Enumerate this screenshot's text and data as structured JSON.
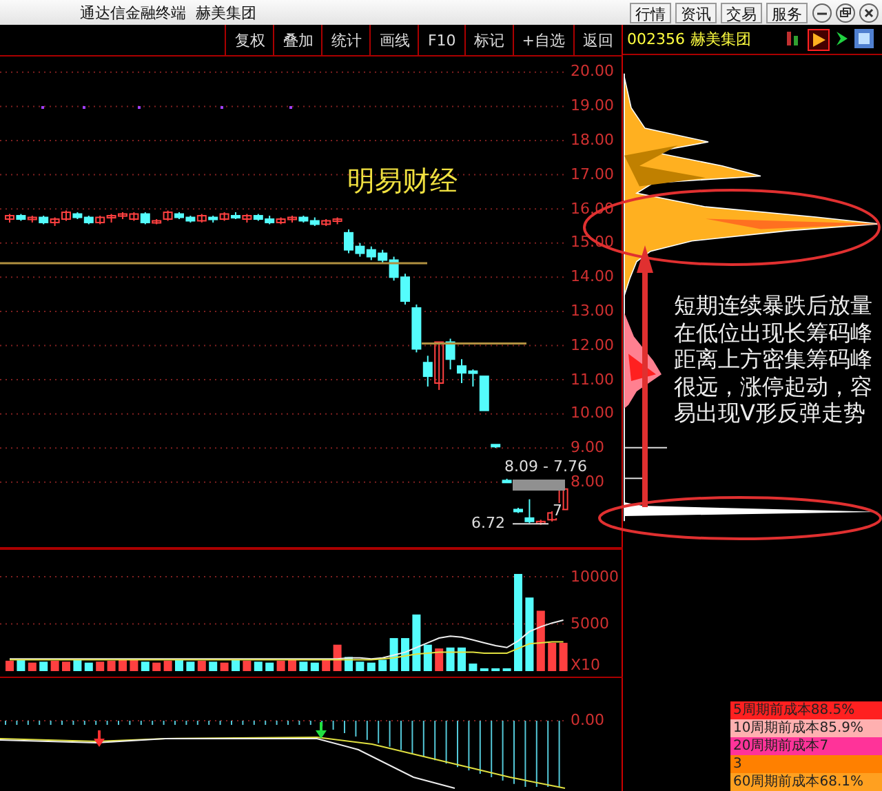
{
  "window": {
    "title": "通达信金融终端  赫美集团"
  },
  "top_buttons": [
    "行情",
    "资讯",
    "交易",
    "服务"
  ],
  "toolbar": {
    "buttons": [
      "复权",
      "叠加",
      "统计",
      "画线",
      "F10",
      "标记",
      "+自选",
      "返回"
    ]
  },
  "stock": {
    "code": "002356",
    "name": "赫美集团"
  },
  "price_chart": {
    "overlay_text": "明易财经",
    "range_label": "8.09 - 7.76",
    "low_label": "6.72",
    "cut_label": "7",
    "chart_data": {
      "type": "candlestick",
      "ohlc": [
        [
          15.7,
          15.85,
          15.6,
          15.8
        ],
        [
          15.8,
          15.85,
          15.65,
          15.7
        ],
        [
          15.7,
          15.8,
          15.6,
          15.75
        ],
        [
          15.75,
          15.8,
          15.55,
          15.6
        ],
        [
          15.6,
          15.75,
          15.5,
          15.7
        ],
        [
          15.7,
          15.95,
          15.65,
          15.9
        ],
        [
          15.85,
          15.9,
          15.7,
          15.75
        ],
        [
          15.75,
          15.8,
          15.55,
          15.6
        ],
        [
          15.6,
          15.8,
          15.55,
          15.75
        ],
        [
          15.75,
          15.85,
          15.6,
          15.8
        ],
        [
          15.8,
          15.9,
          15.7,
          15.85
        ],
        [
          15.7,
          15.9,
          15.65,
          15.85
        ],
        [
          15.85,
          15.9,
          15.55,
          15.6
        ],
        [
          15.6,
          15.7,
          15.55,
          15.65
        ],
        [
          15.7,
          15.95,
          15.65,
          15.9
        ],
        [
          15.85,
          15.9,
          15.7,
          15.75
        ],
        [
          15.75,
          15.8,
          15.6,
          15.65
        ],
        [
          15.65,
          15.85,
          15.6,
          15.8
        ],
        [
          15.75,
          15.8,
          15.6,
          15.7
        ],
        [
          15.7,
          15.9,
          15.65,
          15.85
        ],
        [
          15.8,
          15.9,
          15.7,
          15.75
        ],
        [
          15.7,
          15.85,
          15.6,
          15.8
        ],
        [
          15.8,
          15.85,
          15.65,
          15.7
        ],
        [
          15.7,
          15.8,
          15.55,
          15.6
        ],
        [
          15.6,
          15.75,
          15.55,
          15.7
        ],
        [
          15.7,
          15.8,
          15.6,
          15.75
        ],
        [
          15.75,
          15.8,
          15.6,
          15.65
        ],
        [
          15.65,
          15.75,
          15.5,
          15.55
        ],
        [
          15.55,
          15.7,
          15.5,
          15.65
        ],
        [
          15.65,
          15.75,
          15.55,
          15.7
        ],
        [
          15.3,
          15.4,
          14.7,
          14.8
        ],
        [
          14.9,
          15.0,
          14.6,
          14.7
        ],
        [
          14.8,
          14.9,
          14.5,
          14.6
        ],
        [
          14.7,
          14.8,
          14.4,
          14.5
        ],
        [
          14.5,
          14.6,
          13.9,
          14.0
        ],
        [
          14.0,
          14.1,
          13.2,
          13.3
        ],
        [
          13.1,
          13.2,
          11.8,
          11.9
        ],
        [
          11.5,
          11.7,
          10.8,
          11.1
        ],
        [
          10.9,
          12.1,
          10.7,
          12.1
        ],
        [
          12.1,
          12.2,
          11.3,
          11.6
        ],
        [
          11.4,
          11.6,
          10.9,
          11.2
        ],
        [
          11.25,
          11.3,
          10.8,
          11.2
        ],
        [
          11.1,
          11.1,
          10.1,
          10.1
        ],
        [
          9.1,
          9.1,
          9.0,
          9.05
        ],
        [
          8.05,
          8.1,
          8.0,
          8.0
        ],
        [
          7.2,
          7.25,
          7.1,
          7.15
        ],
        [
          6.95,
          7.5,
          6.8,
          6.85
        ],
        [
          6.8,
          6.9,
          6.75,
          6.85
        ],
        [
          6.9,
          7.15,
          6.85,
          7.1
        ],
        [
          7.2,
          7.8,
          7.2,
          7.8
        ]
      ],
      "ylim": [
        6.1,
        20.5
      ],
      "grid": true,
      "yticks": [
        {
          "value": 20,
          "label": "20.00"
        },
        {
          "value": 19,
          "label": "19.00"
        },
        {
          "value": 18,
          "label": "18.00"
        },
        {
          "value": 17,
          "label": "17.00"
        },
        {
          "value": 16,
          "label": "16.00"
        },
        {
          "value": 15,
          "label": "15.00"
        },
        {
          "value": 14,
          "label": "14.00"
        },
        {
          "value": 13,
          "label": "13.00"
        },
        {
          "value": 12,
          "label": "12.00"
        },
        {
          "value": 11,
          "label": "11.00"
        },
        {
          "value": 10,
          "label": "10.00"
        },
        {
          "value": 9,
          "label": "9.00"
        },
        {
          "value": 8,
          "label": "8.00"
        }
      ]
    }
  },
  "volume_chart": {
    "multiplier": "X10",
    "chart_data": {
      "type": "bar",
      "ylim": [
        0,
        13000
      ],
      "grid": true,
      "series": [
        {
          "type": "bar",
          "colors": [
            "#ff4040",
            "#54fcfc",
            "#ff4040",
            "#54fcfc",
            "#ff4040",
            "#ff4040",
            "#54fcfc",
            "#54fcfc",
            "#ff4040",
            "#ff4040",
            "#ff4040",
            "#ff4040",
            "#54fcfc",
            "#ff4040",
            "#ff4040",
            "#54fcfc",
            "#54fcfc",
            "#ff4040",
            "#54fcfc",
            "#ff4040",
            "#54fcfc",
            "#ff4040",
            "#54fcfc",
            "#54fcfc",
            "#ff4040",
            "#ff4040",
            "#54fcfc",
            "#54fcfc",
            "#ff4040",
            "#ff4040",
            "#54fcfc",
            "#54fcfc",
            "#54fcfc",
            "#54fcfc",
            "#54fcfc",
            "#54fcfc",
            "#54fcfc",
            "#54fcfc",
            "#ff4040",
            "#54fcfc",
            "#54fcfc",
            "#54fcfc",
            "#54fcfc",
            "#54fcfc",
            "#54fcfc",
            "#54fcfc",
            "#54fcfc",
            "#ff4040",
            "#ff4040",
            "#ff4040"
          ],
          "values": [
            1100,
            1200,
            900,
            1000,
            1100,
            1000,
            1300,
            900,
            1000,
            1100,
            1200,
            1300,
            1000,
            900,
            1100,
            1200,
            1000,
            1100,
            1000,
            900,
            1300,
            1100,
            1000,
            900,
            1100,
            1200,
            1000,
            900,
            1300,
            2800,
            1500,
            1000,
            900,
            1200,
            3500,
            3500,
            6000,
            2800,
            2400,
            2500,
            2500,
            800,
            300,
            300,
            300,
            10300,
            7800,
            6400,
            3000,
            3000
          ]
        },
        {
          "type": "line",
          "color": "#eeeeee",
          "values": [
            1300,
            1300,
            1300,
            1300,
            1300,
            1300,
            1300,
            1300,
            1300,
            1300,
            1300,
            1300,
            1300,
            1300,
            1300,
            1300,
            1300,
            1300,
            1300,
            1300,
            1300,
            1300,
            1300,
            1300,
            1300,
            1300,
            1300,
            1300,
            1300,
            1300,
            1400,
            1400,
            1300,
            1400,
            1700,
            2000,
            2500,
            3000,
            3500,
            3700,
            3600,
            3300,
            3000,
            2700,
            2500,
            3200,
            4200,
            4700,
            5100,
            5400
          ]
        },
        {
          "type": "line",
          "color": "#e0e040",
          "values": [
            1200,
            1200,
            1200,
            1200,
            1200,
            1200,
            1200,
            1200,
            1200,
            1200,
            1200,
            1200,
            1200,
            1200,
            1200,
            1200,
            1200,
            1200,
            1200,
            1200,
            1200,
            1200,
            1200,
            1200,
            1200,
            1200,
            1200,
            1200,
            1200,
            1200,
            1200,
            1200,
            1200,
            1300,
            1400,
            1600,
            1800,
            1900,
            2000,
            2000,
            2000,
            2000,
            1900,
            1900,
            1900,
            2400,
            2900,
            3000,
            3100,
            3100
          ]
        }
      ],
      "yticks": [
        {
          "value": 10000,
          "label": "10000"
        },
        {
          "value": 5000,
          "label": "5000"
        }
      ]
    }
  },
  "macd_chart": {
    "axis_labels": [
      "0.00"
    ]
  },
  "chip_panel": {
    "annotation": [
      "短期连续暴跌后放量",
      "在低位出现长筹码峰",
      "距离上方密集筹码峰",
      "很远，涨停起动，容",
      "易出现V形反弹走势"
    ],
    "cost_legend": [
      {
        "label": "5周期前成本88.5%",
        "color": "#ff2020"
      },
      {
        "label": "10周期前成本85.9%",
        "color": "#ffb0b0"
      },
      {
        "label": "20周期前成本7",
        "color": "#ff3399"
      },
      {
        "label": "3",
        "color": "#ff8000"
      },
      {
        "label": "60周期前成本68.1%",
        "color": "#ffa020"
      }
    ]
  }
}
